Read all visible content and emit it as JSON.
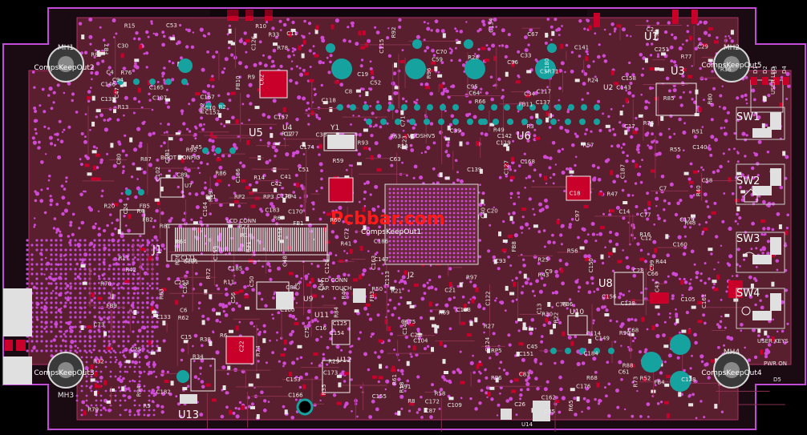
{
  "board": {
    "colors": {
      "background": "#000000",
      "board_fill": "#5a1f2e",
      "outline": "#c24bd8",
      "pad_red": "#c8002a",
      "via": "#d04ad6",
      "hole": "#16a3a0",
      "silk": "#e8e8e8",
      "watermark": "#ff1a1a"
    },
    "watermark": "Pcbbar.com",
    "keepouts": [
      {
        "id": "ko2",
        "text": "CompsKeepOut2"
      },
      {
        "id": "ko3",
        "text": "CompsKeepOut3"
      },
      {
        "id": "ko4",
        "text": "CompsKeepOut4"
      },
      {
        "id": "ko5",
        "text": "CompsKeepOut5"
      },
      {
        "id": "ko1",
        "text": "CompsKeepOut1"
      }
    ],
    "mount_holes": [
      "MH1",
      "MH2",
      "MH3",
      "MH4"
    ],
    "chips": [
      "U1",
      "U2",
      "U3",
      "U4",
      "U5",
      "U6",
      "U7",
      "U8",
      "U9",
      "U10",
      "U11",
      "U12",
      "U13",
      "U14",
      "Y1",
      "J1",
      "J2"
    ],
    "connectors": {
      "lcd": "LCD CONN",
      "lcd2": "LCD CONN",
      "cap_touch": "CAP. TOUCH",
      "boot": "BOOT CONFIG",
      "vddshv5": "VDDSHV5"
    },
    "switches": [
      "SW1",
      "SW2",
      "SW3",
      "SW4"
    ],
    "user_keys": "USER KEYS",
    "user_led": "USER LED",
    "pwr_on": "PWR ON",
    "d5": "D5",
    "leds": [
      "D1",
      "D2",
      "D3",
      "D4"
    ],
    "resistor_packs": [
      "RP1",
      "RP2",
      "RP3",
      "RP4",
      "RP5",
      "RP6"
    ],
    "refdes": [
      "FB1",
      "C2",
      "C3",
      "C4",
      "C5",
      "C6",
      "C7",
      "C8",
      "C9",
      "C10",
      "C11",
      "C12",
      "C13",
      "C14",
      "C15",
      "C16",
      "C17",
      "C18",
      "C19",
      "C20",
      "C21",
      "C22",
      "C23",
      "C24",
      "C25",
      "C26",
      "C27",
      "C28",
      "C29",
      "C30",
      "C33",
      "C34",
      "C36",
      "C38",
      "C39",
      "C40",
      "C41",
      "C42",
      "C43",
      "C44",
      "C45",
      "C47",
      "C48",
      "C49",
      "C50",
      "C51",
      "C52",
      "C53",
      "C56",
      "C58",
      "C59",
      "C61",
      "C62",
      "C63",
      "C64",
      "C66",
      "C67",
      "C68",
      "C70",
      "C71",
      "C72",
      "C73",
      "C75",
      "C76",
      "C77",
      "C80",
      "C83",
      "C85",
      "C87",
      "C88",
      "C89",
      "C92",
      "C93",
      "C94",
      "C95",
      "C96",
      "C97",
      "C99",
      "C100",
      "C102",
      "C104",
      "C105",
      "C107",
      "C109",
      "C113",
      "C114",
      "C115",
      "C116",
      "C117",
      "C118",
      "C119",
      "C120",
      "C121",
      "C122",
      "C123",
      "C124",
      "C125",
      "C126",
      "C127",
      "C128",
      "C132",
      "C133",
      "C134",
      "C136",
      "C137",
      "C138",
      "C139",
      "C140",
      "C141",
      "C142",
      "C143",
      "C144",
      "C146",
      "C147",
      "C149",
      "C150",
      "C151",
      "C152",
      "C153",
      "C154",
      "C155",
      "C156",
      "C157",
      "C158",
      "C159",
      "C160",
      "C161",
      "C162",
      "C163",
      "C164",
      "C165",
      "C166",
      "C167",
      "C168",
      "C170",
      "C171",
      "C172",
      "C173",
      "C174",
      "C175",
      "C176",
      "C177",
      "C178",
      "C179",
      "C180",
      "C181",
      "C182",
      "C183",
      "C184",
      "C185",
      "C186",
      "C187",
      "C251",
      "C253",
      "R1",
      "R2",
      "R3",
      "R4",
      "R5",
      "R6",
      "R8",
      "R9",
      "R10",
      "R11",
      "R12",
      "R13",
      "R14",
      "R15",
      "R16",
      "R17",
      "R18",
      "R19",
      "R20",
      "R21",
      "R22",
      "R23",
      "R24",
      "R25",
      "R26",
      "R27",
      "R28",
      "R29",
      "R30",
      "R31",
      "R32",
      "R33",
      "R34",
      "R35",
      "R36",
      "R38",
      "R40",
      "R41",
      "R42",
      "R43",
      "R44",
      "R45",
      "R46",
      "R47",
      "R48",
      "R49",
      "R50",
      "R51",
      "R52",
      "R54",
      "R55",
      "R56",
      "R57",
      "R58",
      "R59",
      "R60",
      "R61",
      "R62",
      "R63",
      "R64",
      "R65",
      "R66",
      "R67",
      "R68",
      "R69",
      "R70",
      "R71",
      "R72",
      "R73",
      "R74",
      "R75",
      "R76",
      "R77",
      "R78",
      "R79",
      "R80",
      "R81",
      "R82",
      "R83",
      "R84",
      "R85",
      "R86",
      "R87",
      "R88",
      "R89",
      "R90",
      "R91",
      "R92",
      "R93",
      "R94",
      "R95",
      "R96",
      "R97",
      "FB2",
      "FB3",
      "FB4",
      "FB5",
      "FB6",
      "FB7",
      "FB8",
      "FB9",
      "FB10",
      "FB11"
    ]
  }
}
